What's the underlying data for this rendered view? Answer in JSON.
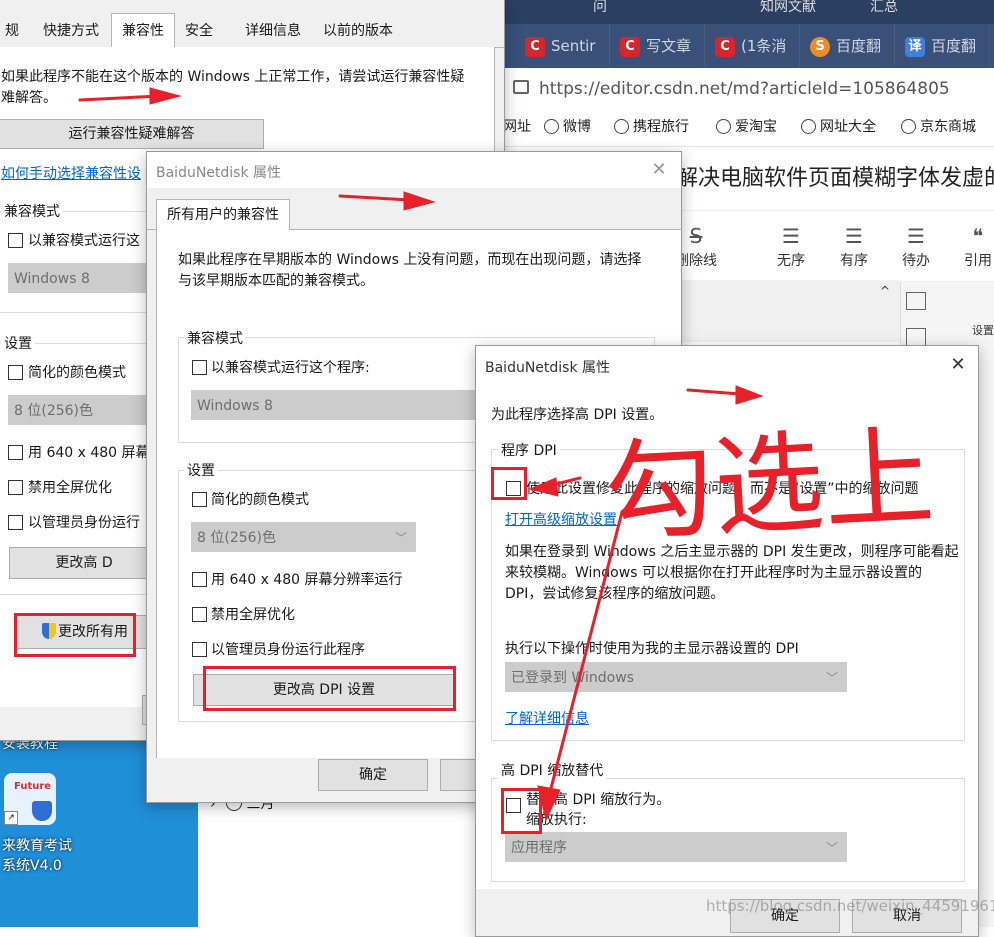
{
  "browser": {
    "top_nav": [
      "问",
      "知网文献",
      "汇总"
    ],
    "tabs": [
      {
        "label": "Sentir",
        "icon": "C"
      },
      {
        "label": "写文章",
        "icon": "C"
      },
      {
        "label": "(1条消",
        "icon": "C"
      },
      {
        "label": "百度翻",
        "icon": "S"
      },
      {
        "label": "百度翻",
        "icon": "译"
      }
    ],
    "url": "https://editor.csdn.net/md?articleId=105864805",
    "bookmarks": [
      "网址",
      "微博",
      "携程旅行",
      "爱淘宝",
      "网址大全",
      "京东商城"
    ],
    "article_title": "解决电脑软件页面模糊字体发虚的",
    "toolbar": [
      {
        "icon": "S",
        "label": "删除线"
      },
      {
        "icon": "☰",
        "label": "无序"
      },
      {
        "icon": "☰",
        "label": "有序"
      },
      {
        "icon": "☰",
        "label": "待办"
      },
      {
        "icon": "❝",
        "label": "引用"
      }
    ],
    "side_settings": "设置"
  },
  "desktop": {
    "icon_label_top": "安装教程",
    "app_icon_label": "来教育考试系统V4.0",
    "app_icon_badge": "Future",
    "month_label": "三月"
  },
  "back_dialog": {
    "tabs": [
      "规",
      "快捷方式",
      "兼容性",
      "安全",
      "详细信息",
      "以前的版本"
    ],
    "intro": "如果此程序不能在这个版本的 Windows 上正常工作，请尝试运行兼容性疑难解答。",
    "troubleshoot_button": "运行兼容性疑难解答",
    "manual_link": "如何手动选择兼容性设",
    "compat_mode_label": "兼容模式",
    "compat_checkbox": "以兼容模式运行这",
    "os_select": "Windows 8",
    "settings_label": "设置",
    "reduced_color": "简化的颜色模式",
    "color_select": "8 位(256)色",
    "res_640": "用 640 x 480 屏幕",
    "disable_fullscreen": "禁用全屏优化",
    "run_admin": "以管理员身份运行",
    "dpi_button": "更改高 D",
    "change_all_button": "更改所有用"
  },
  "mid_dialog": {
    "title": "BaiduNetdisk 属性",
    "tab": "所有用户的兼容性",
    "intro": "如果此程序在早期版本的 Windows 上没有问题，而现在出现问题，请选择与该早期版本匹配的兼容模式。",
    "compat_mode_label": "兼容模式",
    "compat_checkbox": "以兼容模式运行这个程序:",
    "os_select": "Windows 8",
    "settings_label": "设置",
    "reduced_color": "简化的颜色模式",
    "color_select": "8 位(256)色",
    "res_640": "用 640 x 480 屏幕分辨率运行",
    "disable_fullscreen": "禁用全屏优化",
    "run_admin": "以管理员身份运行此程序",
    "dpi_button": "更改高 DPI 设置",
    "ok_button": "确定"
  },
  "front_dialog": {
    "title": "BaiduNetdisk 属性",
    "heading": "为此程序选择高 DPI 设置。",
    "program_dpi_label": "程序 DPI",
    "program_dpi_checkbox": "使用此设置修复此程序的缩放问题，而不是“设置”中的缩放问题",
    "advanced_link": "打开高级缩放设置",
    "desc": "如果在登录到 Windows 之后主显示器的 DPI 发生更改，则程序可能看起来较模糊。Windows 可以根据你在打开此程序时为主显示器设置的 DPI，尝试修复该程序的缩放问题。",
    "dpi_when_label": "执行以下操作时使用为我的主显示器设置的 DPI",
    "dpi_when_select": "已登录到 Windows",
    "learn_more_link": "了解详细信息",
    "override_label": "高 DPI 缩放替代",
    "override_checkbox": "替代高 DPI 缩放行为。",
    "scaling_by": "缩放执行:",
    "scaling_select": "应用程序",
    "ok_button": "确定",
    "cancel_button": "取消"
  },
  "annotation": {
    "handwritten": "勾选上",
    "color": "#e8202a"
  },
  "watermark": "https://blog.csdn.net/weixin_44591961"
}
